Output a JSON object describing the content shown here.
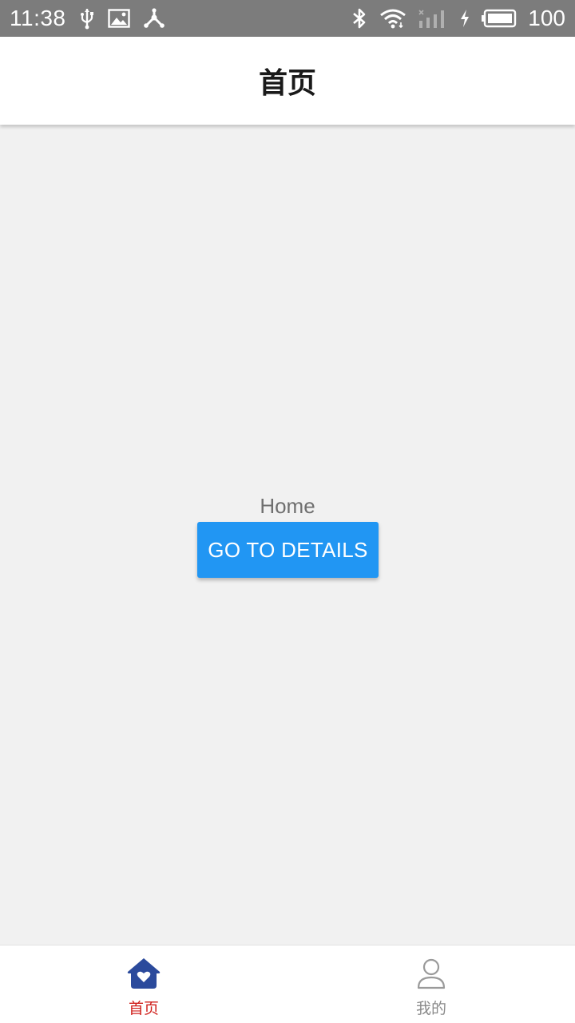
{
  "status_bar": {
    "time": "11:38",
    "battery_level": "100",
    "icons": [
      "usb-icon",
      "image-icon",
      "share-node-icon",
      "bluetooth-icon",
      "wifi-icon",
      "signal-icon",
      "charging-icon",
      "battery-icon"
    ]
  },
  "header": {
    "title": "首页"
  },
  "main": {
    "home_text": "Home",
    "details_button_label": "GO TO DETAILS"
  },
  "tabs": [
    {
      "label": "首页",
      "icon": "home-heart-icon",
      "active": true
    },
    {
      "label": "我的",
      "icon": "person-icon",
      "active": false
    }
  ],
  "colors": {
    "status_bar_bg": "#7c7c7c",
    "accent_button": "#2196f3",
    "active_tab_text": "#d0201c",
    "active_tab_icon": "#2b4a9c",
    "inactive_tab": "#8a8a8a",
    "content_bg": "#f1f1f1"
  }
}
